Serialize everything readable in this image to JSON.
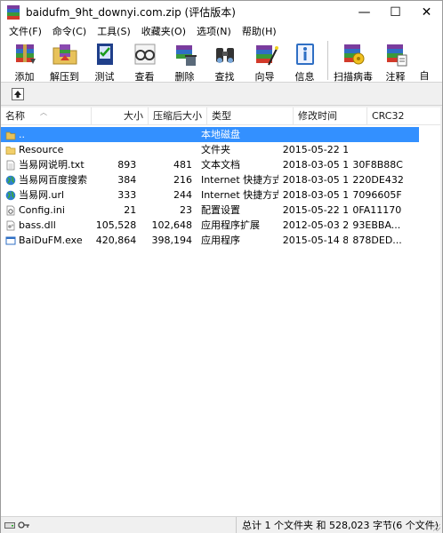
{
  "window": {
    "title": "baidufm_9ht_downyi.com.zip (评估版本)",
    "minimize": "—",
    "maximize": "☐",
    "close": "✕"
  },
  "menu": [
    "文件(F)",
    "命令(C)",
    "工具(S)",
    "收藏夹(O)",
    "选项(N)",
    "帮助(H)"
  ],
  "toolbar": [
    {
      "label": "添加",
      "icon": "add-archive-icon"
    },
    {
      "label": "解压到",
      "icon": "extract-folder-icon"
    },
    {
      "label": "测试",
      "icon": "test-icon"
    },
    {
      "label": "查看",
      "icon": "view-glasses-icon"
    },
    {
      "label": "删除",
      "icon": "delete-icon"
    },
    {
      "label": "查找",
      "icon": "find-binoculars-icon"
    },
    {
      "label": "向导",
      "icon": "wizard-icon"
    },
    {
      "label": "信息",
      "icon": "info-icon"
    },
    {
      "label": "扫描病毒",
      "icon": "scan-virus-icon"
    },
    {
      "label": "注释",
      "icon": "comment-icon"
    },
    {
      "label": "自",
      "icon": "sfx-icon"
    }
  ],
  "columns": [
    "名称",
    "大小",
    "压缩后大小",
    "类型",
    "修改时间",
    "CRC32"
  ],
  "files": [
    {
      "name": "..",
      "size": "",
      "packed": "",
      "type": "本地磁盘",
      "modified": "",
      "crc": "",
      "icon": "up-folder",
      "selected": true
    },
    {
      "name": "Resource",
      "size": "",
      "packed": "",
      "type": "文件夹",
      "modified": "2015-05-22 1...",
      "crc": "",
      "icon": "folder",
      "selected": false
    },
    {
      "name": "当易网说明.txt",
      "size": "893",
      "packed": "481",
      "type": "文本文档",
      "modified": "2018-03-05 1...",
      "crc": "30F8B88C",
      "icon": "text",
      "selected": false
    },
    {
      "name": "当易网百度搜索...",
      "size": "384",
      "packed": "216",
      "type": "Internet 快捷方式",
      "modified": "2018-03-05 1...",
      "crc": "220DE432",
      "icon": "globe",
      "selected": false
    },
    {
      "name": "当易网.url",
      "size": "333",
      "packed": "244",
      "type": "Internet 快捷方式",
      "modified": "2018-03-05 1...",
      "crc": "7096605F",
      "icon": "globe",
      "selected": false
    },
    {
      "name": "Config.ini",
      "size": "21",
      "packed": "23",
      "type": "配置设置",
      "modified": "2015-05-22 1...",
      "crc": "0FA11170",
      "icon": "ini",
      "selected": false
    },
    {
      "name": "bass.dll",
      "size": "105,528",
      "packed": "102,648",
      "type": "应用程序扩展",
      "modified": "2012-05-03 2...",
      "crc": "93EBBA...",
      "icon": "dll",
      "selected": false
    },
    {
      "name": "BaiDuFM.exe",
      "size": "420,864",
      "packed": "398,194",
      "type": "应用程序",
      "modified": "2015-05-14 8...",
      "crc": "878DED...",
      "icon": "exe",
      "selected": false
    }
  ],
  "status": {
    "summary": "总计 1 个文件夹 和 528,023 字节(6 个文件)"
  },
  "colors": {
    "selection": "#3390ff",
    "background": "#ffffff",
    "chrome": "#f0f0f0"
  }
}
